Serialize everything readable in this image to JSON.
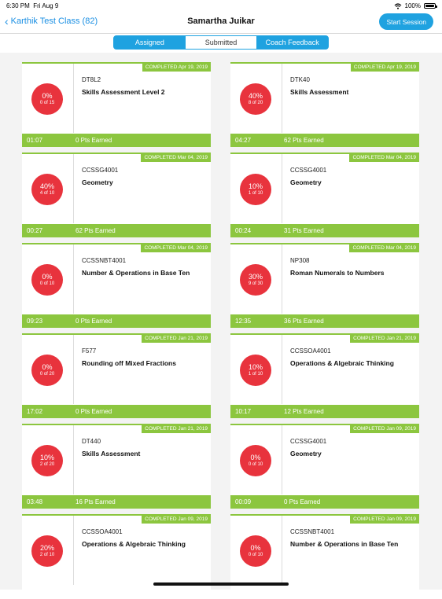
{
  "status": {
    "time": "6:30 PM",
    "date": "Fri Aug 9",
    "battery": "100%"
  },
  "nav": {
    "back_label": "Karthik Test Class (82)",
    "title": "Samartha Juikar",
    "start_button": "Start Session"
  },
  "tabs": [
    {
      "label": "Assigned",
      "active": false
    },
    {
      "label": "Submitted",
      "active": true
    },
    {
      "label": "Coach Feedback",
      "active": false
    }
  ],
  "cards": [
    {
      "completed": "COMPLETED Apr 19, 2019",
      "code": "DT8L2",
      "name": "Skills Assessment Level 2",
      "pct": "0%",
      "count": "0 of 15",
      "time": "01:07",
      "points": "0 Pts Earned"
    },
    {
      "completed": "COMPLETED Apr 19, 2019",
      "code": "DTK40",
      "name": "Skills Assessment",
      "pct": "40%",
      "count": "8 of 20",
      "time": "04:27",
      "points": "62 Pts Earned"
    },
    {
      "completed": "COMPLETED Mar 04, 2019",
      "code": "CCSSG4001",
      "name": "Geometry",
      "pct": "40%",
      "count": "4 of 10",
      "time": "00:27",
      "points": "62 Pts Earned"
    },
    {
      "completed": "COMPLETED Mar 04, 2019",
      "code": "CCSSG4001",
      "name": "Geometry",
      "pct": "10%",
      "count": "1 of 10",
      "time": "00:24",
      "points": "31 Pts Earned"
    },
    {
      "completed": "COMPLETED Mar 04, 2019",
      "code": "CCSSNBT4001",
      "name": "Number & Operations in Base Ten",
      "pct": "0%",
      "count": "0 of 10",
      "time": "09:23",
      "points": "0 Pts Earned"
    },
    {
      "completed": "COMPLETED Mar 04, 2019",
      "code": "NP308",
      "name": "Roman Numerals to Numbers",
      "pct": "30%",
      "count": "9 of 30",
      "time": "12:35",
      "points": "36 Pts Earned"
    },
    {
      "completed": "COMPLETED Jan 21, 2019",
      "code": "F577",
      "name": "Rounding off Mixed Fractions",
      "pct": "0%",
      "count": "0 of 20",
      "time": "17:02",
      "points": "0 Pts Earned"
    },
    {
      "completed": "COMPLETED Jan 21, 2019",
      "code": "CCSSOA4001",
      "name": "Operations & Algebraic Thinking",
      "pct": "10%",
      "count": "1 of 10",
      "time": "10:17",
      "points": "12 Pts Earned"
    },
    {
      "completed": "COMPLETED Jan 21, 2019",
      "code": "DT440",
      "name": "Skills Assessment",
      "pct": "10%",
      "count": "2 of 20",
      "time": "03:48",
      "points": "16 Pts Earned"
    },
    {
      "completed": "COMPLETED Jan 09, 2019",
      "code": "CCSSG4001",
      "name": "Geometry",
      "pct": "0%",
      "count": "0 of 10",
      "time": "00:09",
      "points": "0 Pts Earned"
    },
    {
      "completed": "COMPLETED Jan 09, 2019",
      "code": "CCSSOA4001",
      "name": "Operations & Algebraic Thinking",
      "pct": "20%",
      "count": "2 of 10",
      "time": "",
      "points": ""
    },
    {
      "completed": "COMPLETED Jan 09, 2019",
      "code": "CCSSNBT4001",
      "name": "Number & Operations in Base Ten",
      "pct": "0%",
      "count": "0 of 10",
      "time": "",
      "points": ""
    }
  ],
  "colors": {
    "accent": "#1fa2e0",
    "green": "#8cc63f",
    "badge": "#e8333d"
  }
}
